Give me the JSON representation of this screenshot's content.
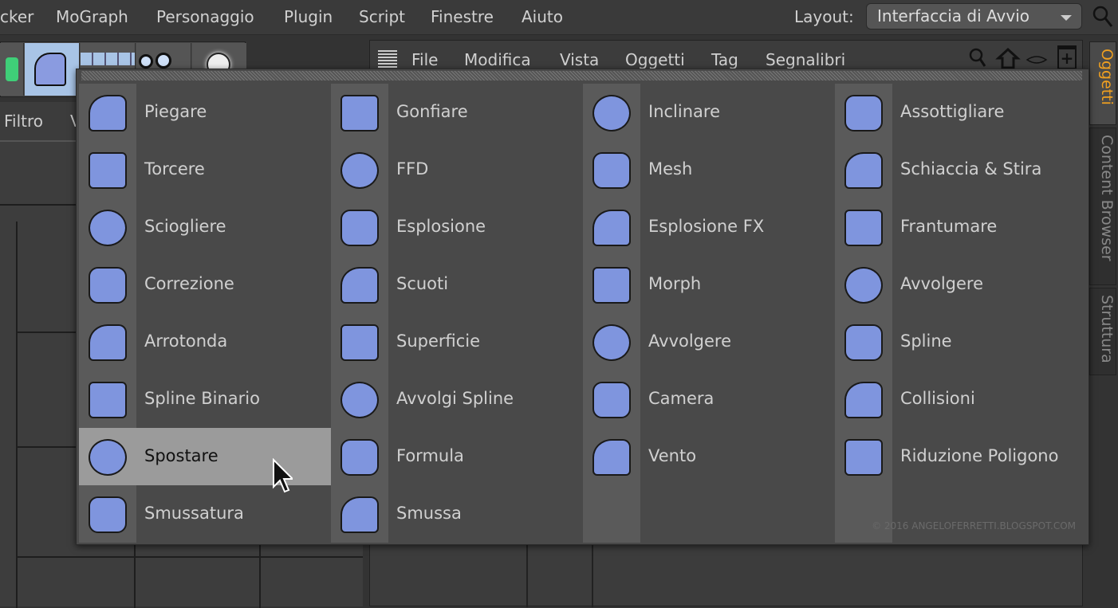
{
  "menubar": {
    "items": [
      "cker",
      "MoGraph",
      "Personaggio",
      "Plugin",
      "Script",
      "Finestre",
      "Aiuto"
    ],
    "layout_label": "Layout:",
    "layout_value": "Interfaccia di Avvio"
  },
  "left": {
    "filter_label": "Filtro",
    "filter_next": "V"
  },
  "object_manager": {
    "menu": [
      "File",
      "Modifica",
      "Vista",
      "Oggetti",
      "Tag",
      "Segnalibri"
    ]
  },
  "side_tabs": [
    "Oggetti",
    "Content Browser",
    "Struttura"
  ],
  "accent": "#f0a020",
  "icon_color": "#7f95de",
  "popup": {
    "columns": [
      [
        "Piegare",
        "Torcere",
        "Sciogliere",
        "Correzione",
        "Arrotonda",
        "Spline Binario",
        "Spostare",
        "Smussatura"
      ],
      [
        "Gonfiare",
        "FFD",
        "Esplosione",
        "Scuoti",
        "Superficie",
        "Avvolgi Spline",
        "Formula",
        "Smussa"
      ],
      [
        "Inclinare",
        "Mesh",
        "Esplosione FX",
        "Morph",
        "Avvolgere",
        "Camera",
        "Vento"
      ],
      [
        "Assottigliare",
        "Schiaccia & Stira",
        "Frantumare",
        "Avvolgere",
        "Spline",
        "Collisioni",
        "Riduzione Poligono"
      ]
    ],
    "highlighted": "Spostare",
    "copyright": "© 2016 ANGELOFERRETTI.BLOGSPOT.COM"
  }
}
